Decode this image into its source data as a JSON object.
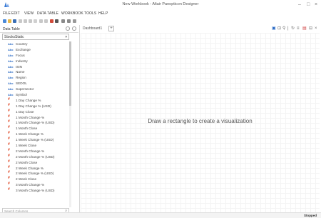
{
  "window": {
    "title": "New Workbook - Altair Panopticon Designer",
    "controls": [
      "–",
      "□",
      "×"
    ]
  },
  "menu": [
    "FILE",
    "EDIT",
    "VIEW",
    "DATA TABLE",
    "WORKBOOK",
    "TOOLS",
    "HELP"
  ],
  "toolbar_icons": [
    "new-icon",
    "open-icon",
    "save-icon",
    "cut-icon",
    "copy-icon",
    "paste-icon",
    "delete-icon",
    "undo-icon",
    "redo-icon",
    "run-icon",
    "refresh-icon",
    "link-icon",
    "filter-icon",
    "arrange-icon"
  ],
  "data_table_panel": {
    "title": "Data Table",
    "source": "StocksStatic",
    "columns": [
      {
        "type": "text",
        "label": "Country"
      },
      {
        "type": "text",
        "label": "Exchange"
      },
      {
        "type": "text",
        "label": "Focus"
      },
      {
        "type": "text",
        "label": "Industry"
      },
      {
        "type": "text",
        "label": "ISIN"
      },
      {
        "type": "text",
        "label": "Name"
      },
      {
        "type": "text",
        "label": "Region"
      },
      {
        "type": "text",
        "label": "SEDOL"
      },
      {
        "type": "text",
        "label": "Supersector"
      },
      {
        "type": "text",
        "label": "Symbol"
      },
      {
        "type": "num",
        "label": "1 Day Change %"
      },
      {
        "type": "num",
        "label": "1 Day Change % (USD)"
      },
      {
        "type": "num",
        "label": "1 Day Close"
      },
      {
        "type": "num",
        "label": "1 Month Change %"
      },
      {
        "type": "num",
        "label": "1 Month Change % (USD)"
      },
      {
        "type": "num",
        "label": "1 Month Close"
      },
      {
        "type": "num",
        "label": "1 Week Change %"
      },
      {
        "type": "num",
        "label": "1 Week Change % (USD)"
      },
      {
        "type": "num",
        "label": "1 Week Close"
      },
      {
        "type": "num",
        "label": "2 Month Change %"
      },
      {
        "type": "num",
        "label": "2 Month Change % (USD)"
      },
      {
        "type": "num",
        "label": "2 Month Close"
      },
      {
        "type": "num",
        "label": "2 Week Change %"
      },
      {
        "type": "num",
        "label": "2 Week Change % (USD)"
      },
      {
        "type": "num",
        "label": "2 Week Close"
      },
      {
        "type": "num",
        "label": "3 Month Change %"
      },
      {
        "type": "num",
        "label": "3 Month Change % (USD)"
      }
    ],
    "search_placeholder": "Search Columns"
  },
  "dashboard": {
    "tab_label": "Dashboard1",
    "add_label": "+",
    "hint": "Draw a rectangle to create a visualization"
  },
  "colors": {
    "text_icon": "#2a6ac4",
    "numeric_icon": "#e05030",
    "canvas_grid": "#f4f4f4"
  },
  "status": "Stopped"
}
